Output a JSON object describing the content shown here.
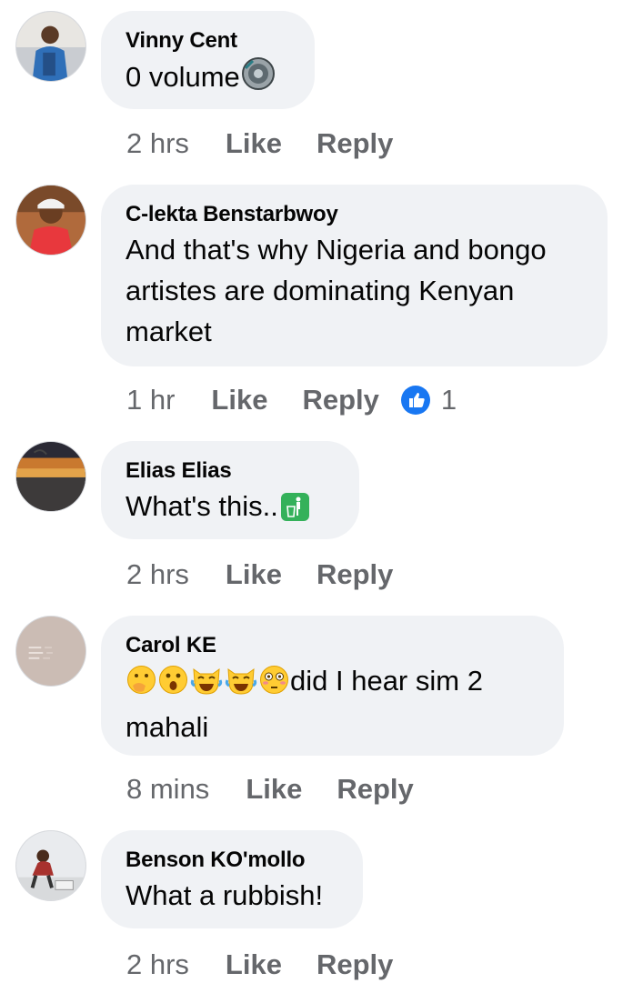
{
  "comments": [
    {
      "author": "Vinny Cent",
      "text": "0 volume",
      "emoji": "speaker-icon",
      "time": "2 hrs",
      "like": "Like",
      "reply": "Reply"
    },
    {
      "author": "C-lekta Benstarbwoy",
      "text_lines": [
        "And that's why Nigeria and bongo",
        "artistes are dominating Kenyan",
        "market"
      ],
      "time": "1 hr",
      "like": "Like",
      "reply": "Reply",
      "reaction": {
        "icon": "thumbs-up-icon",
        "count": "1",
        "color": "#1877f2"
      }
    },
    {
      "author": "Elias Elias",
      "text": "What's this..",
      "emoji": "trash-icon",
      "time": "2 hrs",
      "like": "Like",
      "reply": "Reply"
    },
    {
      "author": "Carol KE",
      "emojis": [
        "face-with-hand-over-mouth",
        "astonished-face",
        "cat-face-with-tears-of-joy",
        "cat-face-with-tears-of-joy",
        "flushed-face"
      ],
      "text_after_emoji": "did I hear sim 2",
      "text_line2": "mahali",
      "time": "8 mins",
      "like": "Like",
      "reply": "Reply"
    },
    {
      "author": "Benson KO'mollo",
      "text": "What a rubbish!",
      "time": "2 hrs",
      "like": "Like",
      "reply": "Reply"
    }
  ],
  "colors": {
    "bubble": "#f0f2f5",
    "meta": "#65676b",
    "text": "#050505",
    "accent": "#1877f2"
  }
}
